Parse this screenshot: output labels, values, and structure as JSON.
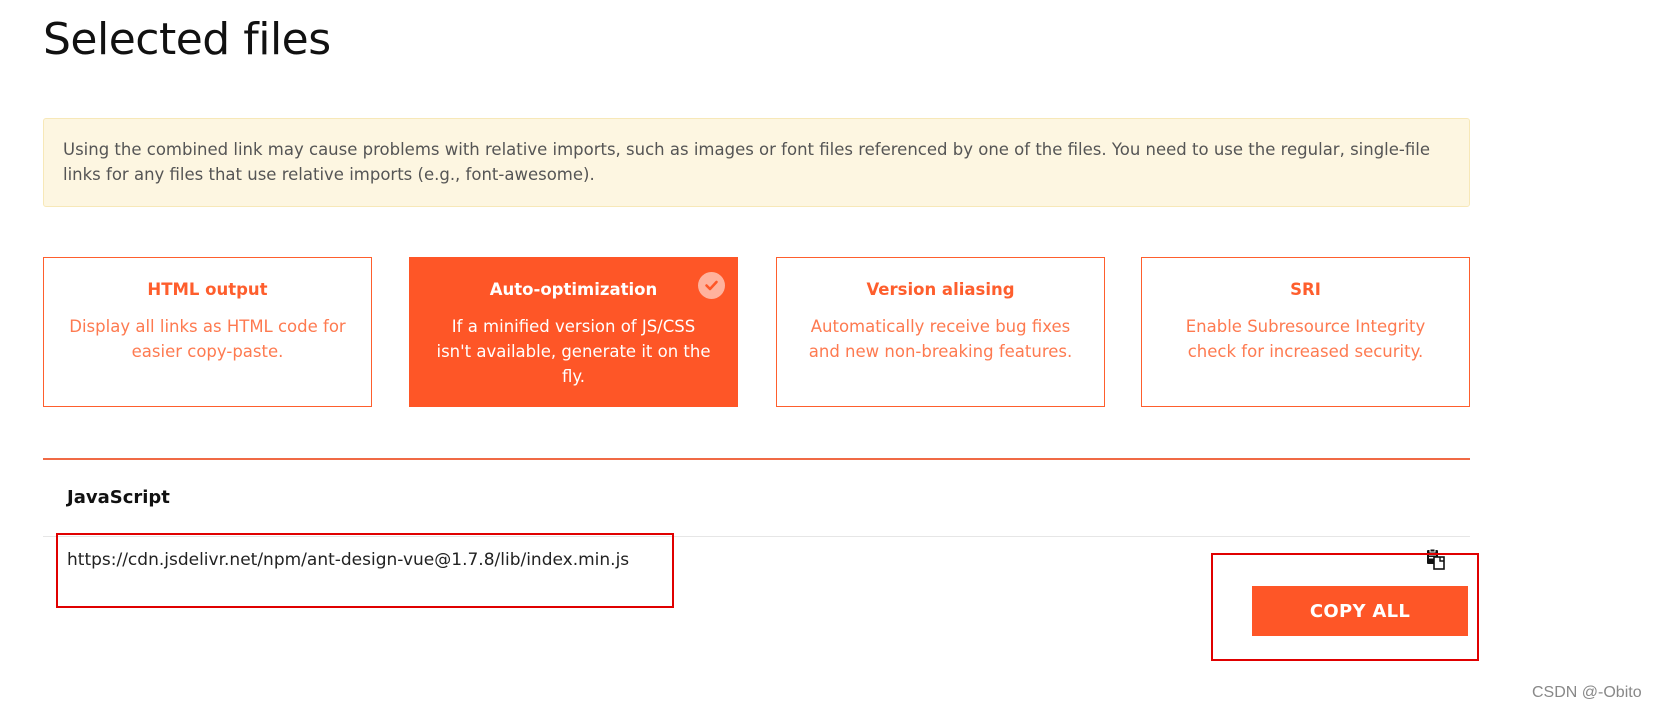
{
  "page": {
    "title": "Selected files"
  },
  "notice": {
    "text": "Using the combined link may cause problems with relative imports, such as images or font files referenced by one of the files. You need to use the regular, single-file links for any files that use relative imports (e.g., font-awesome)."
  },
  "options": [
    {
      "title": "HTML output",
      "desc": "Display all links as HTML code for easier copy-paste.",
      "active": false
    },
    {
      "title": "Auto-optimization",
      "desc": "If a minified version of JS/CSS isn't available, generate it on the fly.",
      "active": true,
      "icon": "check-circle-icon"
    },
    {
      "title": "Version aliasing",
      "desc": "Automatically receive bug fixes and new non-breaking features.",
      "active": false
    },
    {
      "title": "SRI",
      "desc": "Enable Subresource Integrity check for increased security.",
      "active": false
    }
  ],
  "files": {
    "section_label": "JavaScript",
    "link": "https://cdn.jsdelivr.net/npm/ant-design-vue@1.7.8/lib/index.min.js",
    "copy_icon": "clipboard-icon",
    "copy_all_label": "COPY ALL"
  },
  "watermark": "CSDN @-Obito",
  "colors": {
    "accent": "#fe5627",
    "notice_bg": "#fdf6e1",
    "annotation": "#e00000"
  }
}
